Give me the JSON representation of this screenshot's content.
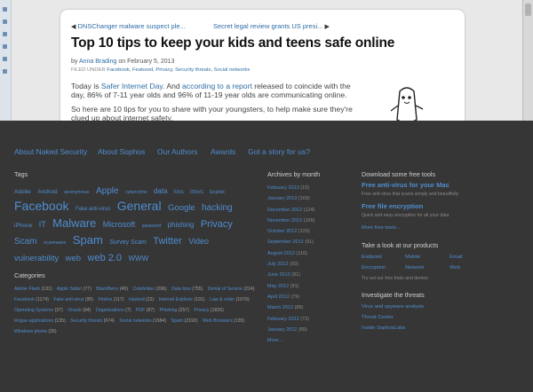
{
  "article": {
    "prev_label": "DNSChanger malware suspect ple...",
    "next_label": "Secret legal review grants US presi...",
    "title": "Top 10 tips to keep your kids and teens safe online",
    "by": "by",
    "author": "Anna Brading",
    "on": "on",
    "date": "February 5, 2013",
    "filed_under": "FILED UNDER",
    "filed_categories": "Facebook, Featured, Privacy, Security threats, Social networks",
    "para1_prefix": "Today is",
    "para1_link1": "Safer Internet Day",
    "para1_mid": ". And",
    "para1_link2": "according to a report",
    "para1_suffix": "released to coincide with the day, 86% of 7-11 year olds and 96% of 11-19 year olds are communicating online.",
    "para2": "So here are 10 tips for you to share with your youngsters, to help make sure they're clued up about internet safety."
  },
  "footer": {
    "nav": [
      "About Naked Security",
      "About Sophos",
      "Our Authors",
      "Awards",
      "Got a story for us?"
    ],
    "tags_title": "Tags",
    "tags": [
      {
        "t": "Adobe",
        "s": 6.5
      },
      {
        "t": "Android",
        "s": 6.5
      },
      {
        "t": "anonymous",
        "s": 5.5
      },
      {
        "t": "Apple",
        "s": 10
      },
      {
        "t": "cybercrime",
        "s": 5
      },
      {
        "t": "data",
        "s": 8
      },
      {
        "t": "loss",
        "s": 6
      },
      {
        "t": "DDoS",
        "s": 5.5
      },
      {
        "t": "Exploit",
        "s": 5.5
      },
      {
        "t": "Facebook",
        "s": 14
      },
      {
        "t": "Fake anti-virus",
        "s": 6
      },
      {
        "t": "General",
        "s": 14
      },
      {
        "t": "Google",
        "s": 9.5
      },
      {
        "t": "hacking",
        "s": 10
      },
      {
        "t": "iPhone",
        "s": 6.5
      },
      {
        "t": "IT",
        "s": 9
      },
      {
        "t": "Malware",
        "s": 13
      },
      {
        "t": "Microsoft",
        "s": 9
      },
      {
        "t": "password",
        "s": 5
      },
      {
        "t": "phishing",
        "s": 8
      },
      {
        "t": "Privacy",
        "s": 11
      },
      {
        "t": "Scam",
        "s": 10
      },
      {
        "t": "scareware",
        "s": 5.5
      },
      {
        "t": "Spam",
        "s": 13
      },
      {
        "t": "Survey Scam",
        "s": 7
      },
      {
        "t": "Twitter",
        "s": 11
      },
      {
        "t": "Video",
        "s": 9
      },
      {
        "t": "vulnerability",
        "s": 9.5
      },
      {
        "t": "web",
        "s": 9.5
      },
      {
        "t": "web 2.0",
        "s": 11
      },
      {
        "t": "WWW",
        "s": 8
      }
    ],
    "categories_title": "Categories",
    "categories": [
      {
        "n": "Adobe Flash",
        "c": "(131)"
      },
      {
        "n": "Apple Safari",
        "c": "(77)"
      },
      {
        "n": "BlackBerry",
        "c": "(45)"
      },
      {
        "n": "Celebrities",
        "c": "(296)"
      },
      {
        "n": "Data loss",
        "c": "(755)"
      },
      {
        "n": "Denial of Service",
        "c": "(214)"
      },
      {
        "n": "Facebook",
        "c": "(1174)"
      },
      {
        "n": "Fake anti-virus",
        "c": "(95)"
      },
      {
        "n": "Firefox",
        "c": "(117)"
      },
      {
        "n": "Hacked",
        "c": "(22)"
      },
      {
        "n": "Internet Explorer",
        "c": "(191)"
      },
      {
        "n": "Law & order",
        "c": "(1070)"
      },
      {
        "n": "Operating Systems",
        "c": "(37)"
      },
      {
        "n": "Oracle",
        "c": "(94)"
      },
      {
        "n": "Organisations",
        "c": "(7)"
      },
      {
        "n": "PDF",
        "c": "(87)"
      },
      {
        "n": "Phishing",
        "c": "(257)"
      },
      {
        "n": "Privacy",
        "c": "(1826)"
      },
      {
        "n": "Rogue applications",
        "c": "(135)"
      },
      {
        "n": "Security threats",
        "c": "(674)"
      },
      {
        "n": "Social networks",
        "c": "(1584)"
      },
      {
        "n": "Spam",
        "c": "(2192)"
      },
      {
        "n": "Web Browsers",
        "c": "(135)"
      },
      {
        "n": "Windows phone",
        "c": "(26)"
      }
    ],
    "archives_title": "Archives by month",
    "archives": [
      {
        "m": "February 2013",
        "c": "(15)"
      },
      {
        "m": "January 2013",
        "c": "(169)"
      },
      {
        "m": "December 2012",
        "c": "(124)"
      },
      {
        "m": "November 2012",
        "c": "(165)"
      },
      {
        "m": "October 2012",
        "c": "(123)"
      },
      {
        "m": "September 2012",
        "c": "(91)"
      },
      {
        "m": "August 2012",
        "c": "(116)"
      },
      {
        "m": "July 2012",
        "c": "(93)"
      },
      {
        "m": "June 2012",
        "c": "(81)"
      },
      {
        "m": "May 2012",
        "c": "(91)"
      },
      {
        "m": "April 2012",
        "c": "(79)"
      },
      {
        "m": "March 2012",
        "c": "(88)"
      },
      {
        "m": "February 2012",
        "c": "(72)"
      },
      {
        "m": "January 2012",
        "c": "(89)"
      },
      {
        "m": "More...",
        "c": ""
      }
    ],
    "download_title": "Download some free tools",
    "tool1_title": "Free anti-virus for your Mac",
    "tool1_desc": "Free anti-virus that scans simply and beautifully",
    "tool2_title": "Free file encryption",
    "tool2_desc": "Quick and easy encryption for all your data",
    "more_tools": "More free tools...",
    "products_title": "Take a look at our products",
    "products": [
      "Endpoint",
      "Mobile",
      "Email",
      "Encryption",
      "Network",
      "Web"
    ],
    "products_trial": "Try out our free trials and demos",
    "threats_title": "Investigate the threats",
    "threats": [
      "Virus and spyware analysis",
      "Threat Center",
      "Inside SophosLabs"
    ]
  }
}
